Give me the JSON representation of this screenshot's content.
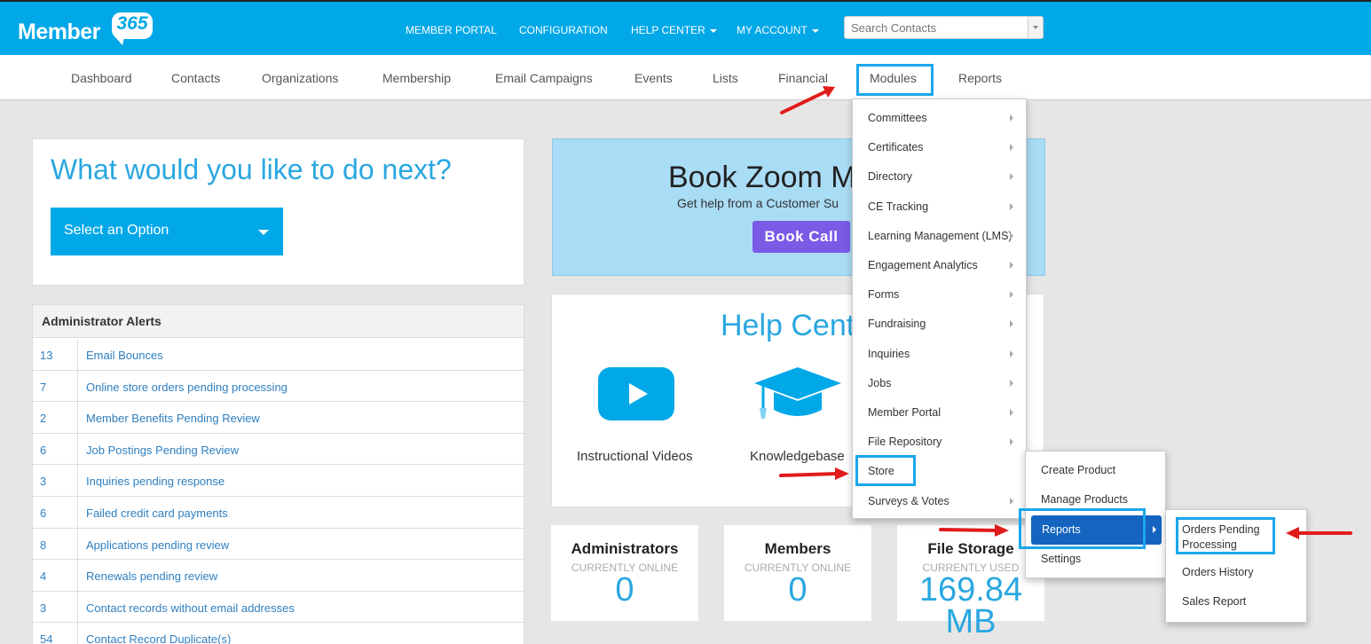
{
  "header": {
    "logo_text": "Member",
    "logo_number": "365",
    "nav": [
      {
        "label": "MEMBER PORTAL",
        "dropdown": false
      },
      {
        "label": "CONFIGURATION",
        "dropdown": false
      },
      {
        "label": "HELP CENTER",
        "dropdown": true
      },
      {
        "label": "MY ACCOUNT",
        "dropdown": true
      }
    ],
    "search": {
      "placeholder": "Search Contacts",
      "value": ""
    }
  },
  "subnav": {
    "items": [
      "Dashboard",
      "Contacts",
      "Organizations",
      "Membership",
      "Email Campaigns",
      "Events",
      "Lists",
      "Financial",
      "Modules",
      "Reports"
    ],
    "active": "Modules"
  },
  "next_card": {
    "title": "What would you like to do next?",
    "select_label": "Select an Option"
  },
  "alerts": {
    "title": "Administrator Alerts",
    "rows": [
      {
        "count": "13",
        "label": "Email Bounces"
      },
      {
        "count": "7",
        "label": "Online store orders pending processing"
      },
      {
        "count": "2",
        "label": "Member Benefits Pending Review"
      },
      {
        "count": "6",
        "label": "Job Postings Pending Review"
      },
      {
        "count": "3",
        "label": "Inquiries pending response"
      },
      {
        "count": "6",
        "label": "Failed credit card payments"
      },
      {
        "count": "8",
        "label": "Applications pending review"
      },
      {
        "count": "4",
        "label": "Renewals pending review"
      },
      {
        "count": "3",
        "label": "Contact records without email addresses"
      },
      {
        "count": "54",
        "label": "Contact Record Duplicate(s)"
      }
    ]
  },
  "zoom_banner": {
    "title": "Book Zoom M",
    "subtitle": "Get help from a Customer Su",
    "button": "Book Call"
  },
  "help_center": {
    "title": "Help Cente",
    "links": [
      {
        "label": "Instructional Videos",
        "icon": "play-icon"
      },
      {
        "label": "Knowledgebase",
        "icon": "graduation-cap-icon"
      }
    ]
  },
  "stats": [
    {
      "title": "Administrators",
      "sub": "CURRENTLY ONLINE",
      "value": "0"
    },
    {
      "title": "Members",
      "sub": "CURRENTLY ONLINE",
      "value": "0"
    },
    {
      "title": "File Storage",
      "sub": "CURRENTLY USED",
      "value": "169.84",
      "unit": "MB"
    }
  ],
  "modules_menu": {
    "items": [
      {
        "label": "Committees",
        "submenu": true
      },
      {
        "label": "Certificates",
        "submenu": true
      },
      {
        "label": "Directory",
        "submenu": true
      },
      {
        "label": "CE Tracking",
        "submenu": true
      },
      {
        "label": "Learning Management (LMS)",
        "submenu": true
      },
      {
        "label": "Engagement Analytics",
        "submenu": true
      },
      {
        "label": "Forms",
        "submenu": true
      },
      {
        "label": "Fundraising",
        "submenu": true
      },
      {
        "label": "Inquiries",
        "submenu": true
      },
      {
        "label": "Jobs",
        "submenu": true
      },
      {
        "label": "Member Portal",
        "submenu": true
      },
      {
        "label": "File Repository",
        "submenu": true
      },
      {
        "label": "Store",
        "submenu": false
      },
      {
        "label": "Surveys & Votes",
        "submenu": true
      }
    ],
    "highlighted": "Store"
  },
  "store_menu": {
    "items": [
      {
        "label": "Create Product",
        "submenu": false
      },
      {
        "label": "Manage Products",
        "submenu": false
      },
      {
        "label": "Reports",
        "submenu": true
      },
      {
        "label": "Settings",
        "submenu": false
      }
    ],
    "active": "Reports"
  },
  "reports_menu": {
    "items": [
      "Orders Pending Processing",
      "Orders History",
      "Sales Report"
    ],
    "highlighted": "Orders Pending Processing"
  },
  "colors": {
    "brand_blue": "#00a8e8",
    "highlight_box": "#1aa7ec",
    "annotation_arrow": "#e11b1b",
    "book_button": "#7b5ae6",
    "active_menu": "#1565c0"
  }
}
